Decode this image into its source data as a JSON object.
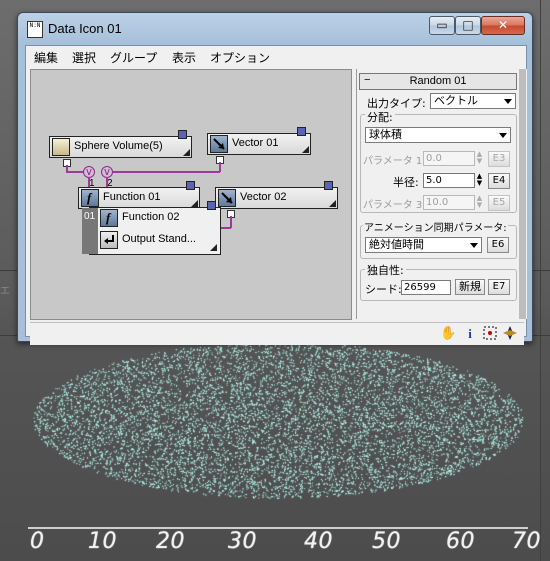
{
  "window": {
    "title": "Data Icon 01",
    "app_icon_text": "N:N",
    "controls": {
      "minimize": "▭",
      "maximize": "□",
      "close": "✕"
    }
  },
  "menu": [
    "編集",
    "選択",
    "グループ",
    "表示",
    "オプション"
  ],
  "viewport": {
    "edge_label": "エ",
    "ruler_ticks": [
      "0",
      "10",
      "20",
      "30",
      "40",
      "50",
      "60",
      "70"
    ],
    "particle_color": "#b8fff4"
  },
  "schematic": {
    "nodes": [
      {
        "label": "Sphere Volume(5)",
        "icon": "sphere-volume-icon"
      },
      {
        "label": "Vector 01",
        "icon": "vector-icon"
      },
      {
        "label": "Function 01",
        "icon": "function-icon"
      },
      {
        "label": "Vector 02",
        "icon": "vector-icon"
      },
      {
        "label": "Function 02",
        "icon": "function-icon"
      },
      {
        "label": "Output Stand...",
        "icon": "output-icon"
      }
    ],
    "socket_label": "V",
    "pin_labels": [
      "1",
      "2"
    ],
    "composite_index": "01"
  },
  "panel": {
    "rollout_title": "Random 01",
    "rollout_toggle": "−",
    "output_type_label": "出力タイプ:",
    "output_type_value": "ベクトル",
    "distribution_group": "分配:",
    "distribution_value": "球体積",
    "params": [
      {
        "label": "パラメータ 1:",
        "value": "0.0",
        "button": "E3",
        "enabled": false
      },
      {
        "label": "半径:",
        "value": "5.0",
        "button": "E4",
        "enabled": true
      },
      {
        "label": "パラメータ 3:",
        "value": "10.0",
        "button": "E5",
        "enabled": false
      }
    ],
    "anim_sync_group": "アニメーション同期パラメータ:",
    "anim_sync_value": "絶対値時間",
    "anim_sync_button": "E6",
    "uniqueness_group": "独自性:",
    "seed_label": "シード:",
    "seed_value": "26599",
    "new_button": "新規",
    "seed_button": "E7"
  },
  "status_icons": [
    "pan-hand-icon",
    "info-icon",
    "region-select-icon",
    "navigate-icon"
  ]
}
